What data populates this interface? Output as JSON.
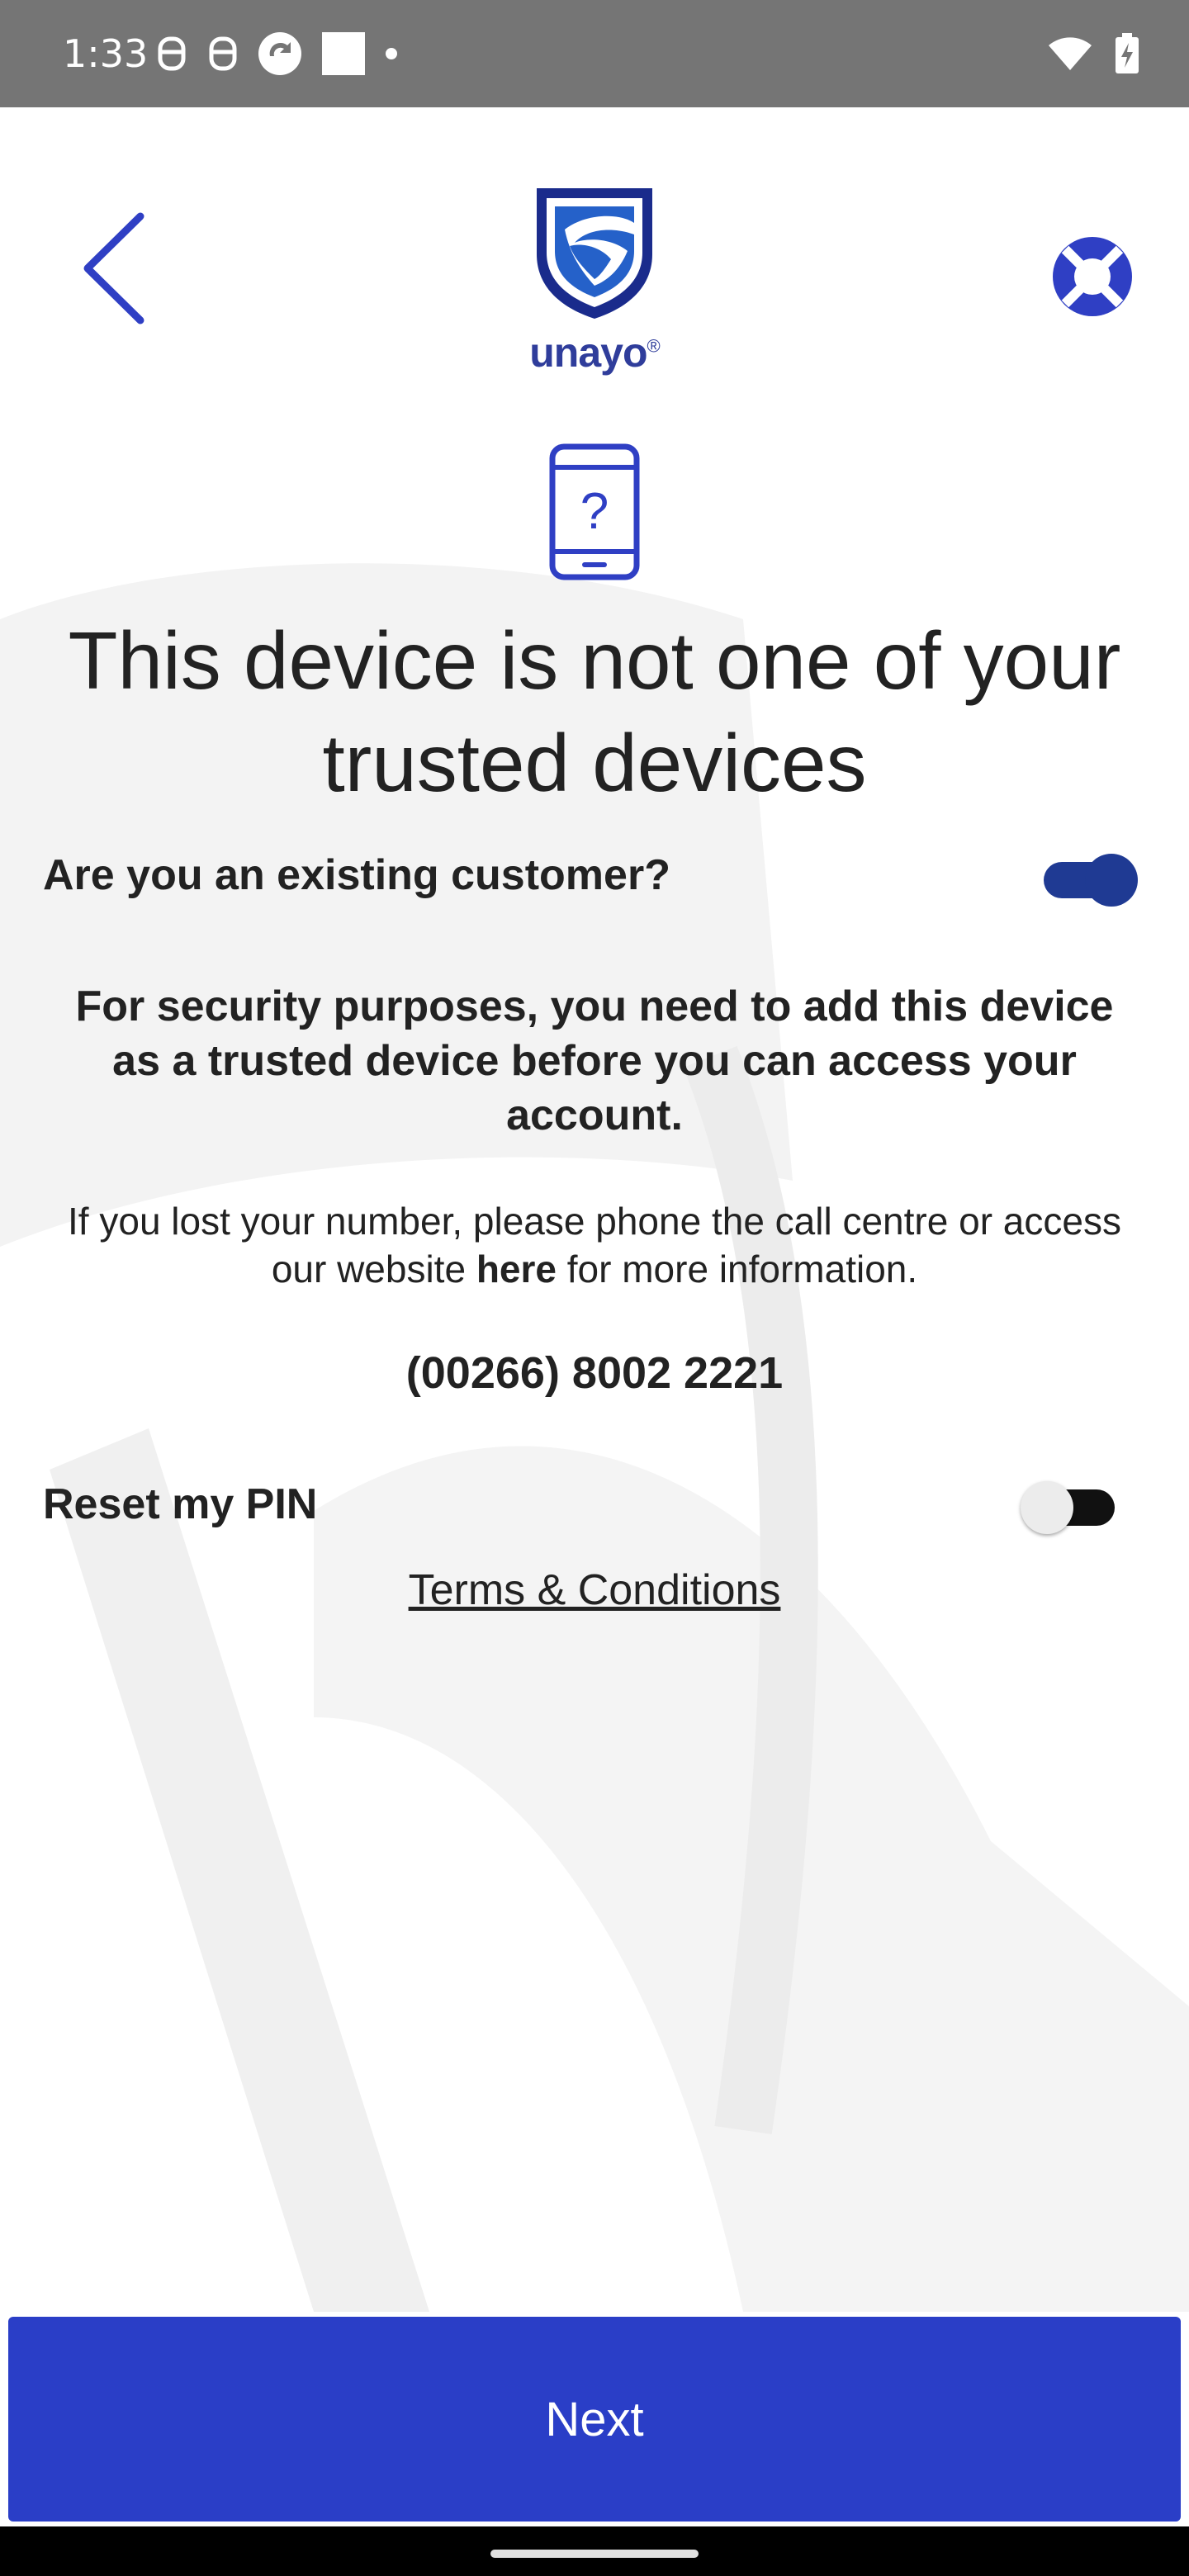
{
  "status_bar": {
    "time": "1:33",
    "left_icons": [
      "notification-icon",
      "notification-icon",
      "sync-icon",
      "square-icon",
      "dot-icon"
    ],
    "right_icons": [
      "wifi-icon",
      "battery-charging-icon"
    ]
  },
  "header": {
    "logo_text": "unayo",
    "logo_mark": "®"
  },
  "title": "This device is not one of your trusted devices",
  "existing_customer": {
    "label": "Are you an existing customer?",
    "on": true
  },
  "security_text": "For security purposes, you need to add this device as a trusted device before you can access your account.",
  "info": {
    "before": "If you lost your number, please phone the call centre or access our website ",
    "link": "here",
    "after": " for more information."
  },
  "phone": "(00266) 8002 2221",
  "reset_pin": {
    "label": "Reset my PIN",
    "on": false
  },
  "terms_label": "Terms & Conditions",
  "next_label": "Next",
  "colors": {
    "brand_blue": "#2a3ec7",
    "toggle_on": "#1f3a93",
    "status_bar": "#757575"
  }
}
